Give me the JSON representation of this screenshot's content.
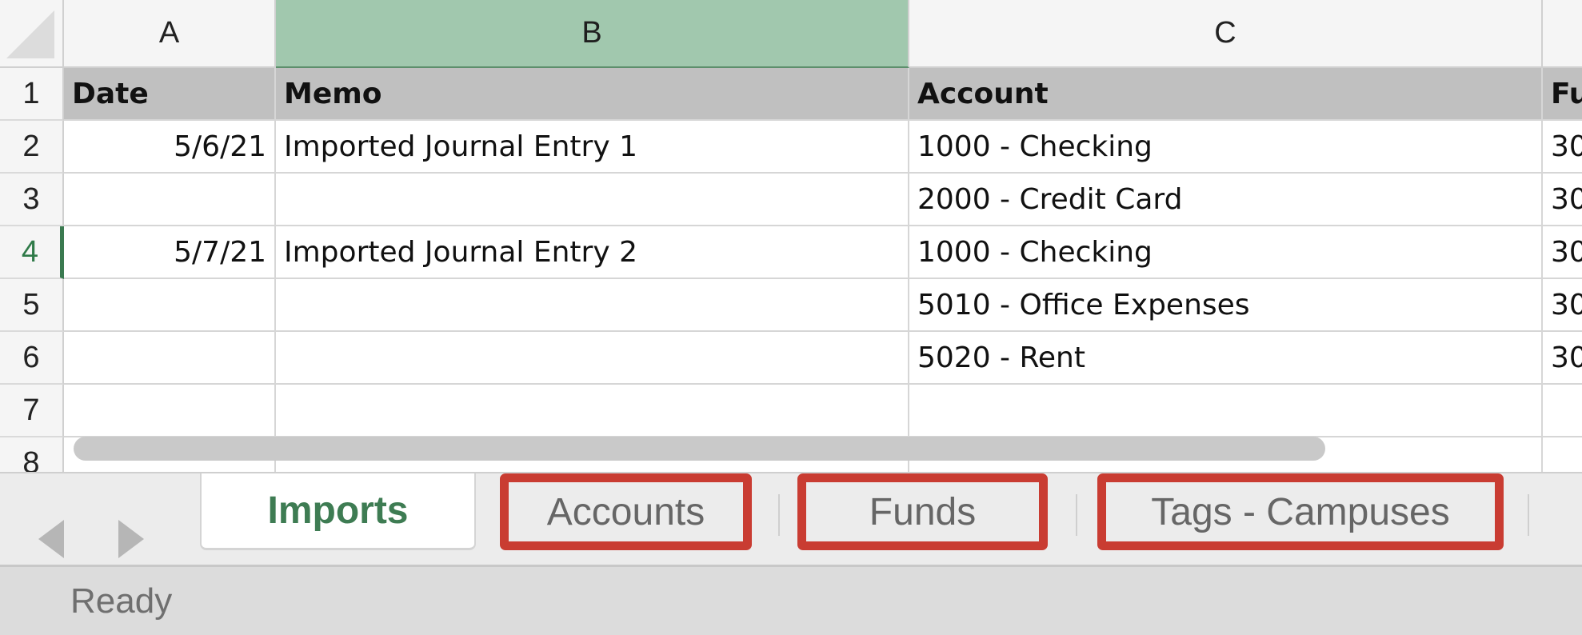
{
  "columns": {
    "a": "A",
    "b": "B",
    "c": "C"
  },
  "rows": [
    "1",
    "2",
    "3",
    "4",
    "5",
    "6",
    "7",
    "8"
  ],
  "header_row": {
    "date": "Date",
    "memo": "Memo",
    "account": "Account",
    "fund": "Fu"
  },
  "data_rows": [
    {
      "date": "5/6/21",
      "memo": "Imported Journal Entry 1",
      "account": "1000 - Checking",
      "fund": "30"
    },
    {
      "date": "",
      "memo": "",
      "account": "2000 - Credit Card",
      "fund": "30"
    },
    {
      "date": "5/7/21",
      "memo": "Imported Journal Entry 2",
      "account": "1000 - Checking",
      "fund": "30"
    },
    {
      "date": "",
      "memo": "",
      "account": "5010 - Office Expenses",
      "fund": "30"
    },
    {
      "date": "",
      "memo": "",
      "account": "5020 - Rent",
      "fund": "30"
    }
  ],
  "selection": {
    "column": "B",
    "row": "4"
  },
  "sheet_tabs": [
    {
      "label": "Imports",
      "active": true,
      "highlighted": false
    },
    {
      "label": "Accounts",
      "active": false,
      "highlighted": true
    },
    {
      "label": "Funds",
      "active": false,
      "highlighted": true
    },
    {
      "label": "Tags - Campuses",
      "active": false,
      "highlighted": true
    }
  ],
  "icons": {
    "prev_sheet": "triangle-left-icon",
    "next_sheet": "triangle-right-icon",
    "select_all": "select-all-corner-icon"
  },
  "colors": {
    "selected_column_header": "#a1c8ae",
    "active_tab_text": "#3e7c53",
    "highlight_outline": "#c93c32",
    "header_row_fill": "#c0c0c0"
  },
  "status": {
    "text": "Ready"
  }
}
